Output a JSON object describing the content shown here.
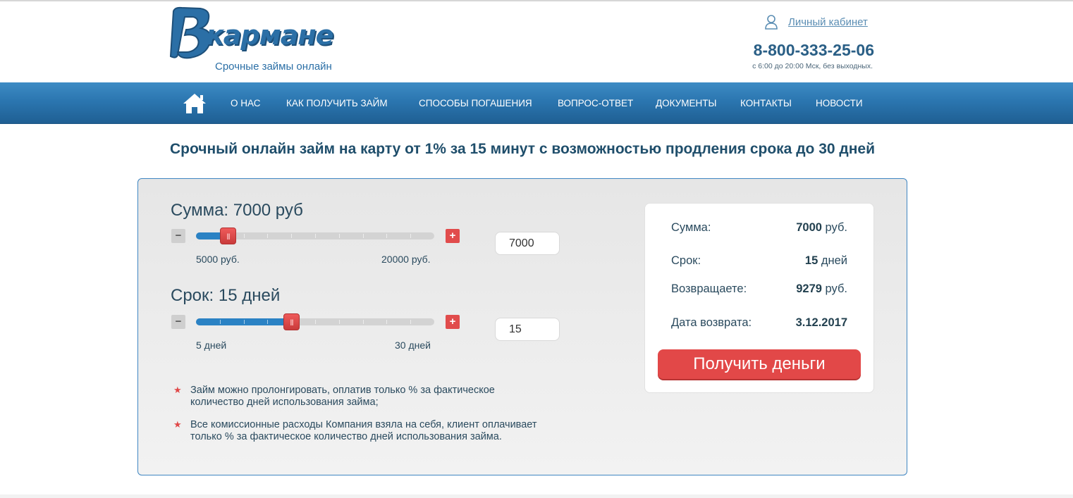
{
  "header": {
    "logo_text": "карман",
    "logo_tail": "е",
    "tagline": "Срочные займы онлайн",
    "cabinet_label": "Личный кабинет",
    "phone": "8-800-333-25-06",
    "hours": "с 6:00 до 20:00 Мск, без выходных."
  },
  "nav": {
    "items": [
      {
        "label": "О нас"
      },
      {
        "label": "Как получить займ"
      },
      {
        "label": "Способы погашения"
      },
      {
        "label": "Вопрос-ответ"
      },
      {
        "label": "Документы"
      },
      {
        "label": "Контакты"
      },
      {
        "label": "Новости"
      }
    ]
  },
  "headline": "Срочный онлайн займ на карту от 1% за 15 минут с возможностью продления срока до 30 дней",
  "calculator": {
    "amount": {
      "title": "Сумма: 7000 руб",
      "value": "7000",
      "min_label": "5000 руб.",
      "max_label": "20000 руб.",
      "min": 5000,
      "max": 20000,
      "current": 7000,
      "minus": "−",
      "plus": "+"
    },
    "term": {
      "title": "Срок: 15 дней",
      "value": "15",
      "min_label": "5 дней",
      "max_label": "30 дней",
      "min": 5,
      "max": 30,
      "current": 15,
      "minus": "−",
      "plus": "+"
    },
    "handle_grip": "|||",
    "notes": [
      "Займ можно пролонгировать, оплатив только % за фактическое количество дней использования займа;",
      "Все комиссионные расходы Компания взяла на себя, клиент оплачивает только % за фактическое количество дней использования займа."
    ]
  },
  "summary": {
    "rows": [
      {
        "label": "Сумма:",
        "value": "7000",
        "unit": " руб."
      },
      {
        "label": "Срок:",
        "value": "15",
        "unit": " дней"
      },
      {
        "label": "Возвращаете:",
        "value": "9279",
        "unit": " руб."
      },
      {
        "label": "Дата возврата:",
        "value": "3.12.2017",
        "unit": ""
      }
    ],
    "button_label": "Получить деньги"
  },
  "colors": {
    "brand_blue": "#2b6fa6",
    "accent_red": "#e24848",
    "nav_blue": "#2b76b0"
  }
}
